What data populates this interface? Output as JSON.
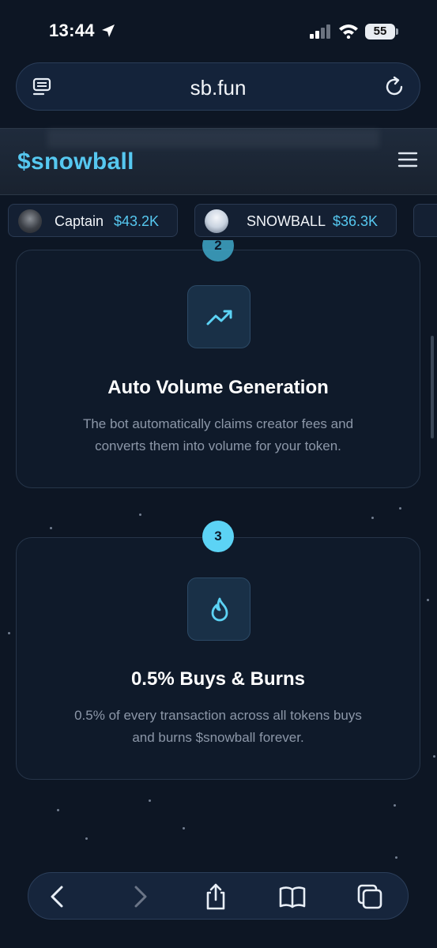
{
  "status_bar": {
    "time": "13:44",
    "battery": "55"
  },
  "browser": {
    "url": "sb.fun"
  },
  "site": {
    "brand": "$snowball"
  },
  "ticker": [
    {
      "name": "Captain",
      "price": "$43.2K"
    },
    {
      "name": "SNOWBALL",
      "price": "$36.3K"
    }
  ],
  "steps": [
    {
      "number": "2",
      "title": "Auto Volume Generation",
      "description_line1": "The bot automatically claims creator fees and",
      "description_line2": "converts them into volume for your token.",
      "icon": "trending-up-icon"
    },
    {
      "number": "3",
      "title": "0.5% Buys & Burns",
      "description_line1": "0.5% of every transaction across all tokens buys",
      "description_line2": "and burns $snowball forever.",
      "icon": "flame-icon"
    }
  ],
  "colors": {
    "accent": "#56c8f0",
    "background": "#0d1624",
    "badge": "#5cd3f5"
  }
}
